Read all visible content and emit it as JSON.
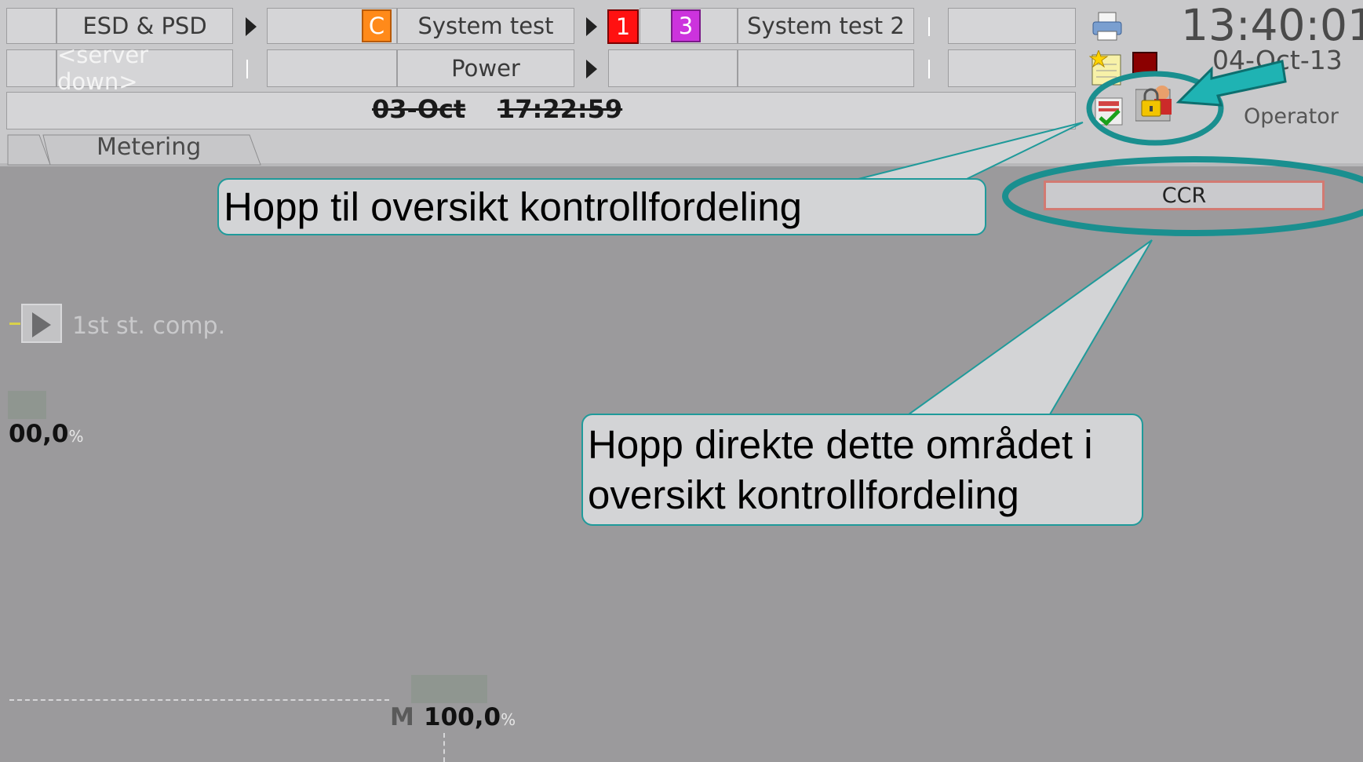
{
  "header": {
    "row1": {
      "area_esd": "ESD & PSD",
      "alarm_c": "C",
      "area_system_test": "System test",
      "alarm_1": "1",
      "alarm_3": "3",
      "area_system_test_2": "System test 2"
    },
    "row2": {
      "server_status": "<server down>",
      "area_power": "Power"
    },
    "row3": {
      "date": "03-Oct",
      "time": "17:22:59"
    },
    "clock": "13:40:01",
    "date_right": "04-Oct-13",
    "user_role": "Operator",
    "icons": [
      "printer-icon",
      "notepad-star-icon",
      "red-square-icon",
      "checklist-icon",
      "lock-user-icon"
    ]
  },
  "tabs": {
    "metering": "Metering"
  },
  "main": {
    "ccr_label": "CCR",
    "compressor_label": "1st st. comp.",
    "value_left": "00,0",
    "value_left_unit": "%",
    "m_label": "M",
    "value_bottom": "100,0",
    "value_bottom_unit": "%"
  },
  "annotations": {
    "callout_top": "Hopp til oversikt kontrollfordeling",
    "callout_bottom_line1": "Hopp direkte dette området i",
    "callout_bottom_line2": "oversikt kontrollfordeling"
  },
  "colors": {
    "annotation_teal": "#1f9a9a",
    "alarm_orange": "#ff8a1a",
    "alarm_red": "#ff1111",
    "alarm_magenta": "#cc33dd",
    "ccr_border": "#d27a72"
  }
}
